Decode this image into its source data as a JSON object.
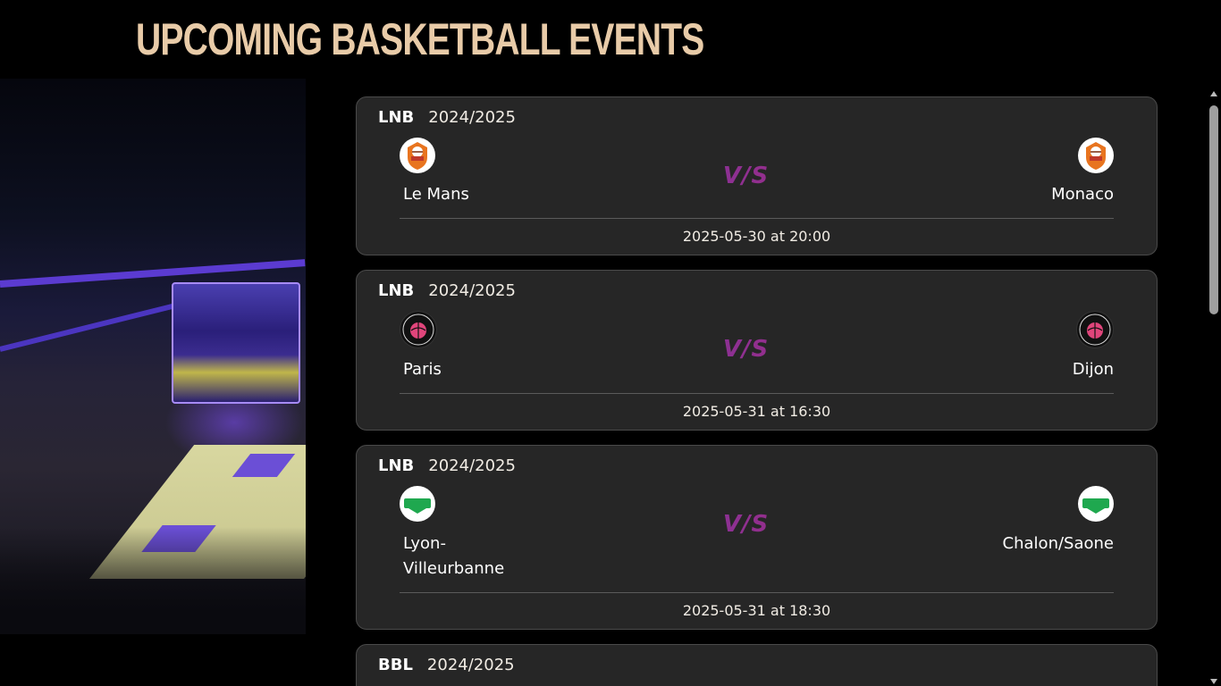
{
  "page": {
    "title": "Upcoming Basketball Events"
  },
  "events": [
    {
      "league": "LNB",
      "season": "2024/2025",
      "home": {
        "name": "Le Mans",
        "logo": "monaco-badge-icon"
      },
      "away": {
        "name": "Monaco",
        "logo": "monaco-badge-icon"
      },
      "vs": "V/S",
      "datetime": "2025-05-30 at 20:00"
    },
    {
      "league": "LNB",
      "season": "2024/2025",
      "home": {
        "name": "Paris",
        "logo": "paris-basketball-icon"
      },
      "away": {
        "name": "Dijon",
        "logo": "paris-basketball-icon"
      },
      "vs": "V/S",
      "datetime": "2025-05-31 at 16:30"
    },
    {
      "league": "LNB",
      "season": "2024/2025",
      "home": {
        "name": "Lyon-Villeurbanne",
        "logo": "asvel-icon"
      },
      "away": {
        "name": "Chalon/Saone",
        "logo": "asvel-icon"
      },
      "vs": "V/S",
      "datetime": "2025-05-31 at 18:30"
    },
    {
      "league": "BBL",
      "season": "2024/2025"
    }
  ],
  "colors": {
    "title": "#e8cba8",
    "card_bg": "#262626",
    "vs_start": "#5b3fc4",
    "vs_end": "#c4205c"
  }
}
